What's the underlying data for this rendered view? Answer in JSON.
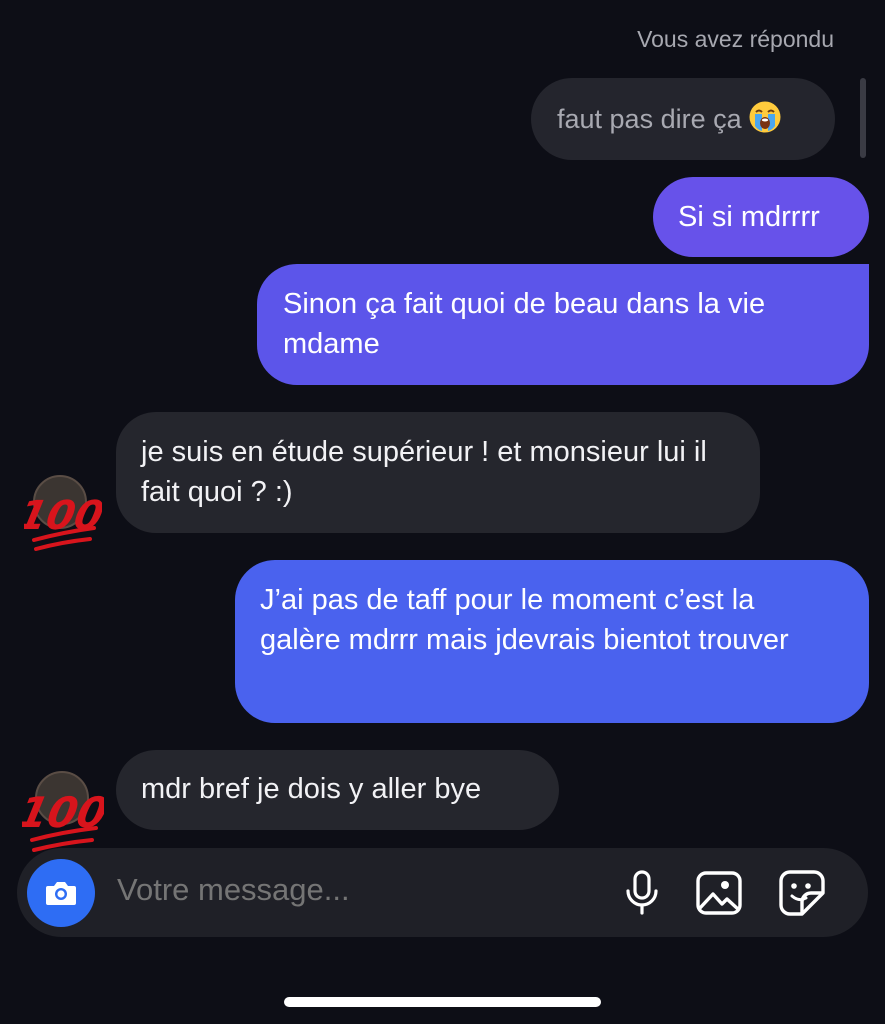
{
  "thread": {
    "reply_label": "Vous avez répondu",
    "quoted_message": {
      "text": "faut pas dire ça",
      "emoji": "loudly-crying-face-emoji"
    },
    "messages": [
      {
        "from": "me",
        "text": "Si si mdrrrr"
      },
      {
        "from": "me",
        "text": "Sinon ça fait quoi de beau dans la vie mdame"
      },
      {
        "from": "them",
        "text": "je suis en étude supérieur ! et monsieur lui il fait quoi ? :)"
      },
      {
        "from": "me",
        "text": "J’ai pas de taff pour le moment c’est la galère mdrrr mais jdevrais bientot trouver"
      },
      {
        "from": "them",
        "text": "mdr bref je dois y aller bye"
      }
    ]
  },
  "avatar": {
    "icon": "hundred-points-emoji-avatar"
  },
  "composer": {
    "placeholder": "Votre message...",
    "icons": [
      "camera-icon",
      "microphone-icon",
      "gallery-icon",
      "sticker-icon"
    ]
  },
  "colors": {
    "background": "#0d0e16",
    "incoming_bubble": "#25262d",
    "outgoing_purple": "#6752ea",
    "outgoing_blue": "#4a62ee",
    "camera_button": "#2e6df4"
  }
}
